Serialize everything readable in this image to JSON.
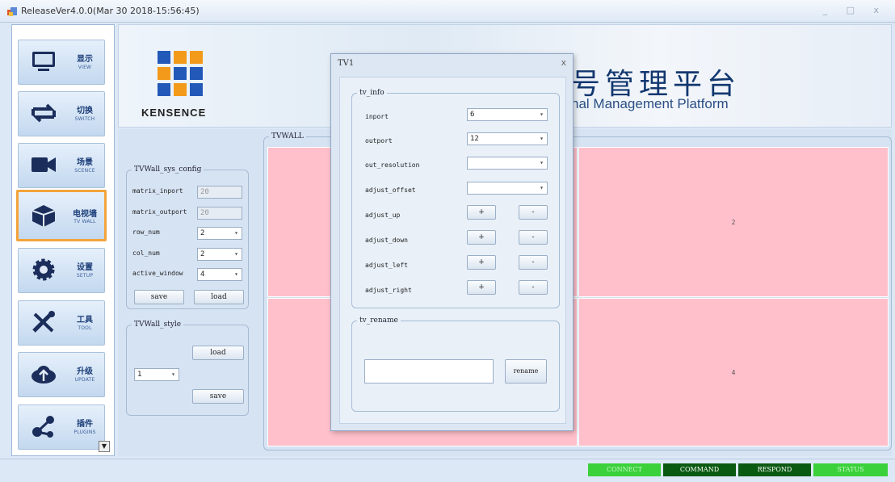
{
  "window": {
    "title": "ReleaseVer4.0.0(Mar 30 2018-15:56:45)",
    "controls": "_ □ x"
  },
  "colors": {
    "active_nav_border": "#f3a43b",
    "tv_cell": "#ffc0cb",
    "status_green": "#3ad13a",
    "status_dark": "#0b5a12"
  },
  "nav": [
    {
      "cn": "显示",
      "en": "VIEW",
      "icon": "monitor-icon"
    },
    {
      "cn": "切换",
      "en": "SWITCH",
      "icon": "switch-arrows-icon"
    },
    {
      "cn": "场景",
      "en": "SCENCE",
      "icon": "video-camera-icon"
    },
    {
      "cn": "电视墙",
      "en": "TV WALL",
      "icon": "cube-icon",
      "active": true
    },
    {
      "cn": "设置",
      "en": "SETUP",
      "icon": "gear-icon"
    },
    {
      "cn": "工具",
      "en": "TOOL",
      "icon": "tools-icon"
    },
    {
      "cn": "升级",
      "en": "UPDATE",
      "icon": "cloud-upload-icon"
    },
    {
      "cn": "插件",
      "en": "PLUGINS",
      "icon": "share-nodes-icon"
    }
  ],
  "banner": {
    "logo_text": "KENSENCE",
    "cn_title": "号管理平台",
    "en_title": "nal Management Platform"
  },
  "sys_config": {
    "legend": "TVWall_sys_config",
    "matrix_inport_label": "matrix_inport",
    "matrix_inport": "20",
    "matrix_outport_label": "matrix_outport",
    "matrix_outport": "20",
    "row_num_label": "row_num",
    "row_num": "2",
    "col_num_label": "col_num",
    "col_num": "2",
    "active_window_label": "active_window",
    "active_window": "4",
    "save": "save",
    "load": "load"
  },
  "style_panel": {
    "legend": "TVWall_style",
    "load": "load",
    "select": "1",
    "save": "save"
  },
  "tvwall": {
    "legend": "TVWALL",
    "cells": [
      "",
      "2",
      "",
      "4"
    ]
  },
  "dialog": {
    "title": "TV1",
    "close": "x",
    "tv_info_legend": "tv_info",
    "inport_label": "inport",
    "inport": "6",
    "outport_label": "outport",
    "outport": "12",
    "out_resolution_label": "out_resolution",
    "out_resolution": "",
    "adjust_offset_label": "adjust_offset",
    "adjust_offset": "",
    "adjust_up_label": "adjust_up",
    "adjust_down_label": "adjust_down",
    "adjust_left_label": "adjust_left",
    "adjust_right_label": "adjust_right",
    "plus": "+",
    "minus": "-",
    "tv_rename_legend": "tv_rename",
    "rename_value": "",
    "rename": "rename"
  },
  "status": {
    "connect": "CONNECT",
    "command": "COMMAND",
    "respond": "RESPOND",
    "status": "STATUS"
  }
}
